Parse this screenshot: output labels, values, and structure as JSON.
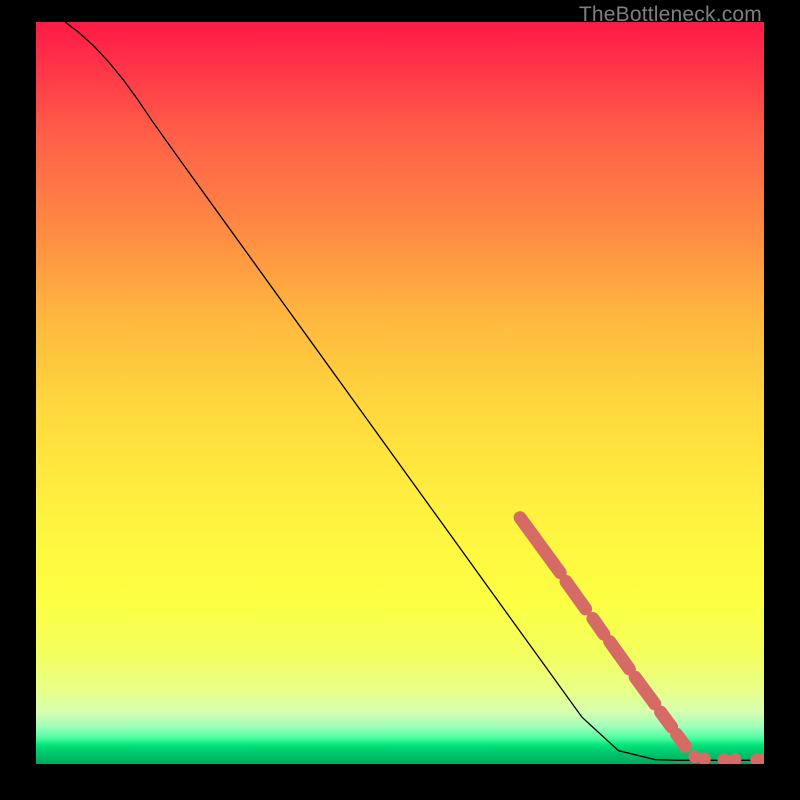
{
  "watermark": "TheBottleneck.com",
  "chart_data": {
    "type": "line",
    "title": "",
    "xlabel": "",
    "ylabel": "",
    "xlim": [
      0,
      100
    ],
    "ylim": [
      0,
      100
    ],
    "curve": {
      "x": [
        4,
        6,
        8,
        10,
        12,
        14,
        16,
        20,
        25,
        30,
        35,
        40,
        45,
        50,
        55,
        60,
        65,
        70,
        75,
        80,
        85,
        88,
        90,
        93,
        100
      ],
      "y": [
        100,
        98.5,
        96.7,
        94.6,
        92.2,
        89.5,
        86.6,
        81.1,
        74.3,
        67.5,
        60.7,
        53.9,
        47.1,
        40.3,
        33.5,
        26.7,
        19.9,
        13.1,
        6.3,
        1.8,
        0.6,
        0.5,
        0.5,
        0.5,
        0.5
      ]
    },
    "marker_segments": [
      {
        "x": [
          66.5,
          72.0
        ],
        "y": [
          33.2,
          25.8
        ]
      },
      {
        "x": [
          72.8,
          75.5
        ],
        "y": [
          24.6,
          20.9
        ]
      },
      {
        "x": [
          76.5,
          78.0
        ],
        "y": [
          19.6,
          17.5
        ]
      },
      {
        "x": [
          78.8,
          81.5
        ],
        "y": [
          16.5,
          12.8
        ]
      },
      {
        "x": [
          82.3,
          85.0
        ],
        "y": [
          11.7,
          8.1
        ]
      },
      {
        "x": [
          85.8,
          87.3
        ],
        "y": [
          7.0,
          5.0
        ]
      },
      {
        "x": [
          88.0,
          89.2
        ],
        "y": [
          4.0,
          2.4
        ]
      }
    ],
    "marker_dots": [
      {
        "x": 90.5,
        "y": 1.0
      },
      {
        "x": 91.8,
        "y": 0.7
      },
      {
        "x": 94.5,
        "y": 0.6
      },
      {
        "x": 96.0,
        "y": 0.6
      },
      {
        "x": 99.0,
        "y": 0.6
      },
      {
        "x": 100.0,
        "y": 0.6
      }
    ]
  }
}
